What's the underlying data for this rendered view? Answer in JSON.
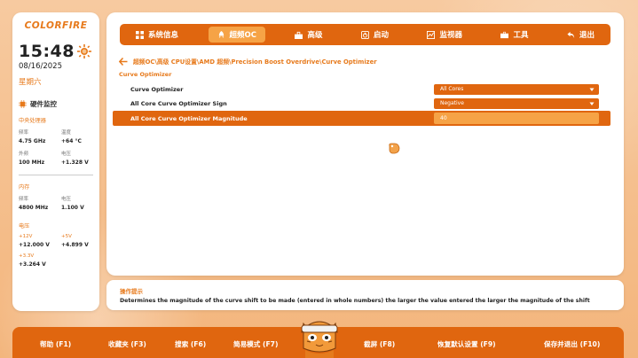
{
  "brand": {
    "logo": "COLORFIRE"
  },
  "clock": {
    "time": "15:48",
    "date": "08/16/2025",
    "weekday": "星期六"
  },
  "hardware": {
    "title": "硬件监控",
    "cpu": {
      "title": "中央处理器",
      "freq_label": "频率",
      "freq_value": "4.75 GHz",
      "temp_label": "温度",
      "temp_value": "+64 °C",
      "bclk_label": "外频",
      "bclk_value": "100 MHz",
      "volt_label": "电压",
      "volt_value": "+1.328 V"
    },
    "memory": {
      "title": "内存",
      "freq_label": "频率",
      "freq_value": "4800 MHz",
      "volt_label": "电压",
      "volt_value": "1.100 V"
    },
    "voltage": {
      "title": "电压",
      "v12_label": "+12V",
      "v12_value": "+12.000 V",
      "v5_label": "+5V",
      "v5_value": "+4.899 V",
      "v33_label": "+3.3V",
      "v33_value": "+3.264 V"
    }
  },
  "nav": {
    "items": [
      {
        "label": "系统信息",
        "icon": "grid-icon",
        "active": false
      },
      {
        "label": "超频OC",
        "icon": "rocket-icon",
        "active": true
      },
      {
        "label": "高级",
        "icon": "toolbox-icon",
        "active": false
      },
      {
        "label": "启动",
        "icon": "power-icon",
        "active": false
      },
      {
        "label": "监视器",
        "icon": "chart-icon",
        "active": false
      },
      {
        "label": "工具",
        "icon": "briefcase-icon",
        "active": false
      },
      {
        "label": "退出",
        "icon": "return-icon",
        "active": false
      }
    ]
  },
  "main": {
    "breadcrumb": "超频OC\\高级 CPU设置\\AMD 超频\\Precision Boost Overdrive\\Curve Optimizer",
    "group_title": "Curve Optimizer",
    "rows": [
      {
        "label": "Curve Optimizer",
        "value": "All Cores",
        "type": "dropdown"
      },
      {
        "label": "All Core Curve Optimizer Sign",
        "value": "Negative",
        "type": "dropdown"
      },
      {
        "label": "All Core Curve Optimizer Magnitude",
        "value": "40",
        "type": "input"
      }
    ]
  },
  "help": {
    "title": "操作提示",
    "text": "Determines the magnitude of the curve shift to be made (entered in whole numbers) the larger the value entered the larger the magnitude of the shift"
  },
  "footer": {
    "keys": [
      "帮助 (F1)",
      "收藏夹 (F3)",
      "搜索 (F6)",
      "简易模式 (F7)",
      "截屏 (F8)",
      "恢复默认设置 (F9)",
      "保存并退出 (F10)"
    ]
  },
  "colors": {
    "accent": "#e0660f",
    "accent_light": "#f6a346",
    "text_orange": "#e77a1c"
  }
}
